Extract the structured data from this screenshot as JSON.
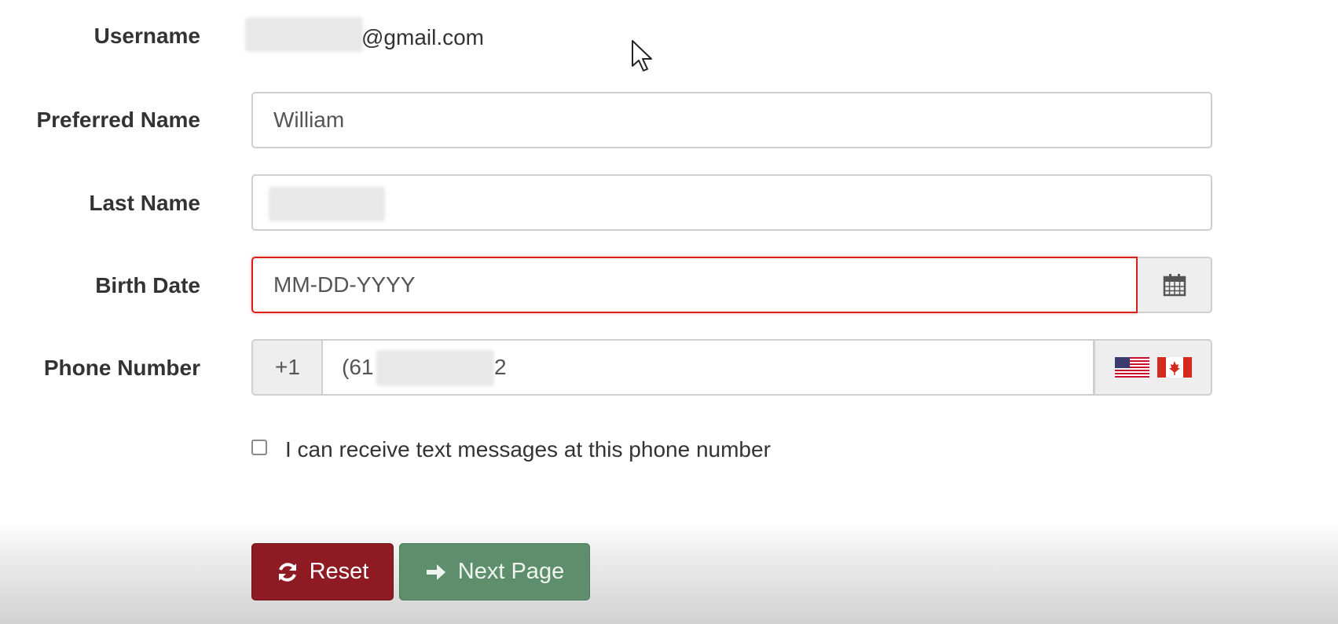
{
  "form": {
    "username": {
      "label": "Username",
      "value": "@gmail.com"
    },
    "preferred_name": {
      "label": "Preferred Name",
      "value": "William"
    },
    "last_name": {
      "label": "Last Name"
    },
    "birth_date": {
      "label": "Birth Date",
      "placeholder": "MM-DD-YYYY"
    },
    "phone": {
      "label": "Phone Number",
      "country_code": "+1",
      "value_start": "(61",
      "value_end": "2",
      "flags": [
        "us-flag-icon",
        "canada-flag-icon"
      ]
    },
    "sms_opt_in": {
      "label": "I can receive text messages at this phone number",
      "checked": false
    }
  },
  "actions": {
    "reset_label": "Reset",
    "next_label": "Next Page"
  },
  "colors": {
    "error_border": "#d9201b",
    "reset_bg": "#8e1b24",
    "next_bg": "#5f8e6d"
  }
}
